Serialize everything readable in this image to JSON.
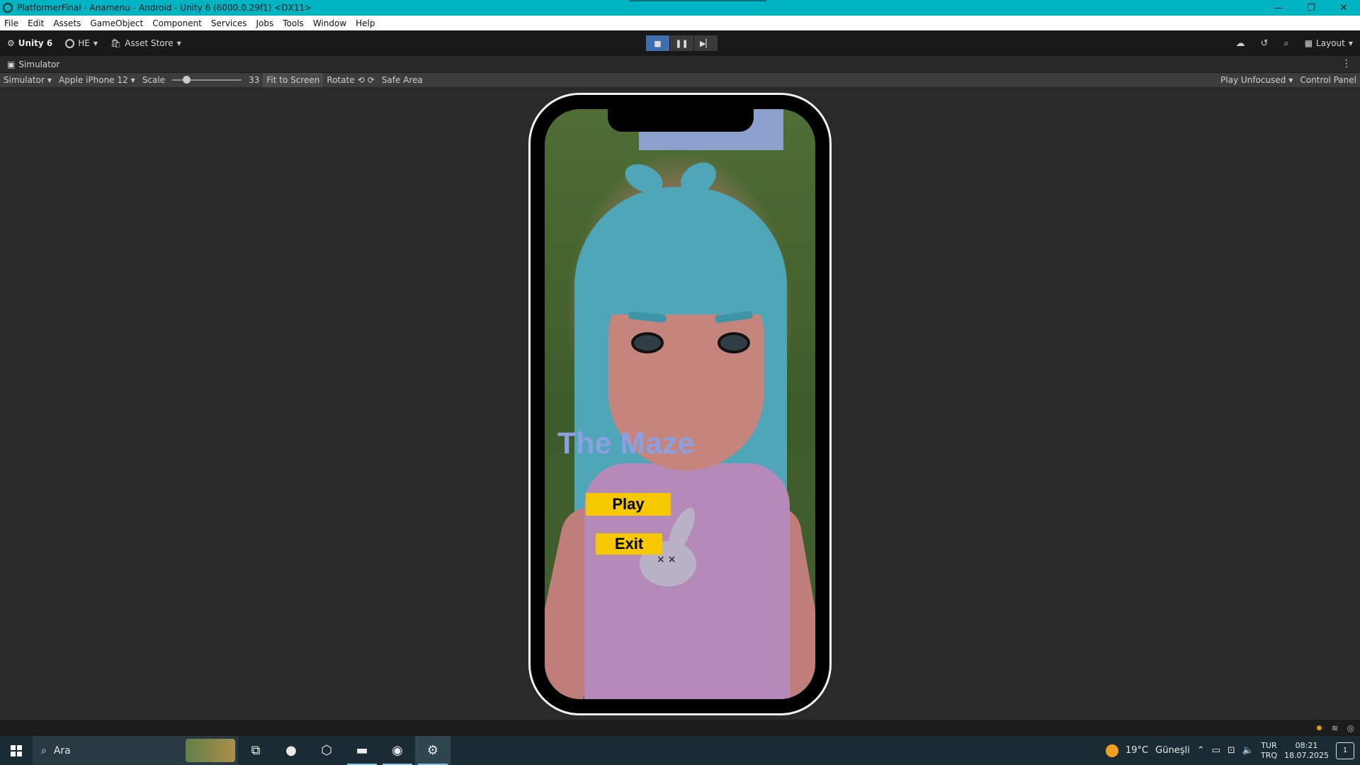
{
  "window": {
    "title": "PlatformerFinal - Anamenu - Android - Unity 6 (6000.0.29f1) <DX11>",
    "controls": {
      "minimize": "—",
      "maximize": "❐",
      "close": "✕"
    }
  },
  "menubar": [
    "File",
    "Edit",
    "Assets",
    "GameObject",
    "Component",
    "Services",
    "Jobs",
    "Tools",
    "Window",
    "Help"
  ],
  "toolbar": {
    "unity_label": "Unity 6",
    "account": "HE",
    "asset_store": "Asset Store",
    "layout": "Layout",
    "play_controls": {
      "stop": "■",
      "pause": "❚❚",
      "step": "▶▏"
    }
  },
  "simulator": {
    "tab_label": "Simulator",
    "mode": "Simulator",
    "device": "Apple iPhone 12",
    "scale_label": "Scale",
    "scale_value": "33",
    "scale_fraction": 0.2,
    "fit_to_screen": "Fit to Screen",
    "rotate": "Rotate",
    "safe_area": "Safe Area",
    "play_mode": "Play Unfocused",
    "control_panel": "Control Panel"
  },
  "game": {
    "title": "The Maze",
    "play_button": "Play",
    "exit_button": "Exit",
    "colors": {
      "title": "#8c9fe0",
      "button": "#f5c800"
    }
  },
  "taskbar": {
    "search_placeholder": "Ara",
    "weather_temp": "19°C",
    "weather_desc": "Güneşli",
    "lang_top": "TUR",
    "lang_bottom": "TRQ",
    "time": "08:21",
    "date": "18.07.2025",
    "notif_count": "1"
  },
  "colors": {
    "titlebar": "#00b4c4",
    "accent": "#3d6fae"
  }
}
